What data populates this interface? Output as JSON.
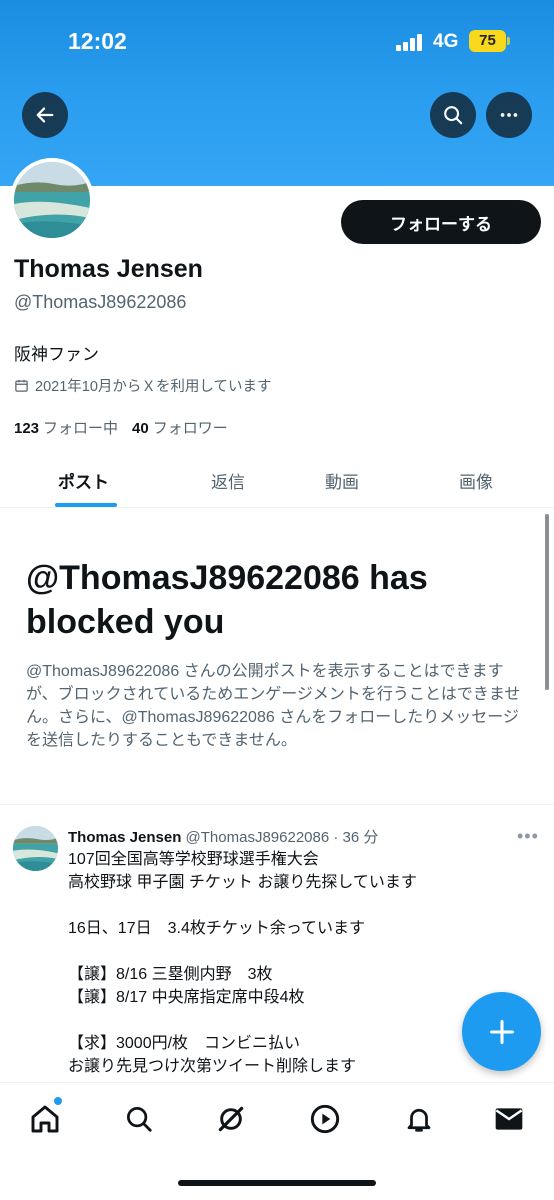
{
  "status_bar": {
    "time": "12:02",
    "network": "4G",
    "battery": "75"
  },
  "profile": {
    "follow_label": "フォローする",
    "name": "Thomas Jensen",
    "handle": "@ThomasJ89622086",
    "bio": "阪神ファン",
    "joined": "2021年10月からＸを利用しています",
    "following_count": "123",
    "following_label": "フォロー中",
    "followers_count": "40",
    "followers_label": "フォロワー"
  },
  "tabs": [
    "ポスト",
    "返信",
    "動画",
    "画像"
  ],
  "blocked": {
    "title": "@ThomasJ89622086 has blocked you",
    "description": "@ThomasJ89622086 さんの公開ポストを表示することはできますが、ブロックされているためエンゲージメントを行うことはできません。さらに、@ThomasJ89622086 さんをフォローしたりメッセージを送信したりすることもできません。"
  },
  "tweet": {
    "name": "Thomas Jensen",
    "handle": "@ThomasJ89622086",
    "time": "· 36 分",
    "body": "107回全国高等学校野球選手権大会\n高校野球 甲子園 チケット お譲り先探しています\n\n 16日、17日　3.4枚チケット余っています\n\n【譲】8/16 三塁側内野　3枚\n【譲】8/17  中央席指定席中段4枚\n\n【求】3000円/枚　コンビニ払い\nお譲り先見つけ次第ツイート削除します"
  },
  "nav": [
    "home-icon",
    "search-icon",
    "grok-icon",
    "video-icon",
    "notifications-icon",
    "messages-icon"
  ],
  "colors": {
    "accent": "#1d9bf0",
    "banner": "#2b9ef0",
    "text": "#0f1419",
    "muted": "#536471"
  }
}
